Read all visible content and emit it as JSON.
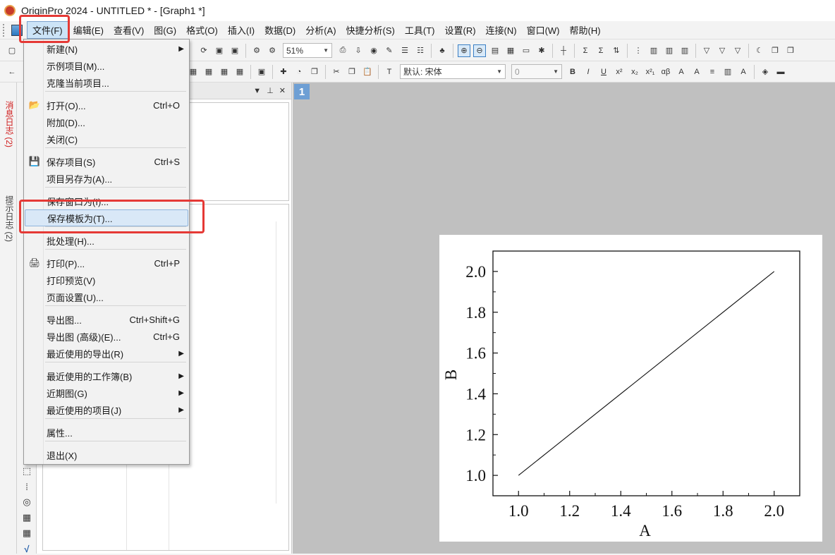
{
  "window": {
    "title": "OriginPro 2024 - UNTITLED * - [Graph1 *]"
  },
  "menubar": {
    "items": [
      "文件(F)",
      "编辑(E)",
      "查看(V)",
      "图(G)",
      "格式(O)",
      "插入(I)",
      "数据(D)",
      "分析(A)",
      "快捷分析(S)",
      "工具(T)",
      "设置(R)",
      "连接(N)",
      "窗口(W)",
      "帮助(H)"
    ],
    "active_index": 0
  },
  "toolbar": {
    "zoom": "51%",
    "font_combo": "默认: 宋体",
    "size_combo": "0",
    "format_buttons": [
      "B",
      "I",
      "U",
      "x²",
      "x₂",
      "x²₁",
      "αβ",
      "A",
      "A"
    ]
  },
  "side_tabs": {
    "messages": "消息日志 (2)",
    "hints": "提示日志 (2)"
  },
  "file_menu": {
    "items": [
      {
        "label": "新建(N)",
        "shortcut": "",
        "submenu": true
      },
      {
        "label": "示例项目(M)...",
        "shortcut": "",
        "submenu": false
      },
      {
        "label": "克隆当前项目...",
        "shortcut": "",
        "submenu": false
      },
      {
        "label": "打开(O)...",
        "shortcut": "Ctrl+O",
        "submenu": false
      },
      {
        "label": "附加(D)...",
        "shortcut": "",
        "submenu": false
      },
      {
        "label": "关闭(C)",
        "shortcut": "",
        "submenu": false
      },
      {
        "label": "保存项目(S)",
        "shortcut": "Ctrl+S",
        "submenu": false
      },
      {
        "label": "项目另存为(A)...",
        "shortcut": "",
        "submenu": false
      },
      {
        "label": "保存窗口为(I)...",
        "shortcut": "",
        "submenu": false
      },
      {
        "label": "保存模板为(T)...",
        "shortcut": "",
        "submenu": false
      },
      {
        "label": "批处理(H)...",
        "shortcut": "",
        "submenu": false
      },
      {
        "label": "打印(P)...",
        "shortcut": "Ctrl+P",
        "submenu": false
      },
      {
        "label": "打印预览(V)",
        "shortcut": "",
        "submenu": false
      },
      {
        "label": "页面设置(U)...",
        "shortcut": "",
        "submenu": false
      },
      {
        "label": "导出图...",
        "shortcut": "Ctrl+Shift+G",
        "submenu": false
      },
      {
        "label": "导出图 (高级)(E)...",
        "shortcut": "Ctrl+G",
        "submenu": false
      },
      {
        "label": "最近使用的导出(R)",
        "shortcut": "",
        "submenu": true
      },
      {
        "label": "最近使用的工作簿(B)",
        "shortcut": "",
        "submenu": true
      },
      {
        "label": "近期图(G)",
        "shortcut": "",
        "submenu": true
      },
      {
        "label": "最近使用的项目(J)",
        "shortcut": "",
        "submenu": true
      },
      {
        "label": "属性...",
        "shortcut": "",
        "submenu": false
      },
      {
        "label": "退出(X)",
        "shortcut": "",
        "submenu": false
      }
    ],
    "hovered_index": 9
  },
  "graph_window": {
    "number": "1"
  },
  "chart_data": {
    "type": "line",
    "x": [
      1.0,
      2.0
    ],
    "y": [
      1.0,
      2.0
    ],
    "xlabel": "A",
    "ylabel": "B",
    "xlim": [
      0.9,
      2.1
    ],
    "ylim": [
      0.9,
      2.1
    ],
    "xticks": [
      "1.0",
      "1.2",
      "1.4",
      "1.6",
      "1.8",
      "2.0"
    ],
    "yticks": [
      "1.0",
      "1.2",
      "1.4",
      "1.6",
      "1.8",
      "2.0"
    ],
    "grid": false
  }
}
